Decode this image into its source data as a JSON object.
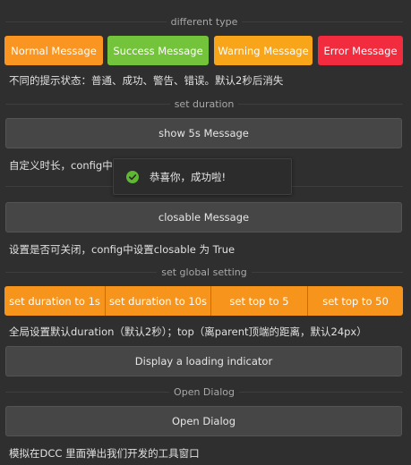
{
  "sections": {
    "different_type": "different type",
    "set_duration": "set duration",
    "set_global_setting": "set global setting",
    "open_dialog": "Open Dialog"
  },
  "type_buttons": {
    "normal": "Normal Message",
    "success": "Success Message",
    "warning": "Warning Message",
    "error": "Error Message"
  },
  "descriptions": {
    "types": "不同的提示状态：普通、成功、警告、错误。默认2秒后消失",
    "duration": "自定义时长，config中",
    "closable": "设置是否可关闭，config中设置closable 为 True",
    "global": "全局设置默认duration（默认2秒）；top（离parent顶端的距离，默认24px）",
    "dialog": "模拟在DCC 里面弹出我们开发的工具窗口"
  },
  "buttons": {
    "show_5s": "show 5s Message",
    "closable": "closable Message",
    "loading": "Display a loading indicator",
    "open_dialog": "Open Dialog"
  },
  "global_settings": [
    "set duration to 1s",
    "set duration to 10s",
    "set top to 5",
    "set top to 50"
  ],
  "toast": {
    "text": "恭喜你，成功啦!",
    "icon": "check-circle-icon",
    "color": "#5fb832"
  },
  "colors": {
    "normal": "#fa9521",
    "success": "#74c43b",
    "warning": "#f8a51a",
    "error": "#f22b3f",
    "background": "#2f2f2f"
  }
}
